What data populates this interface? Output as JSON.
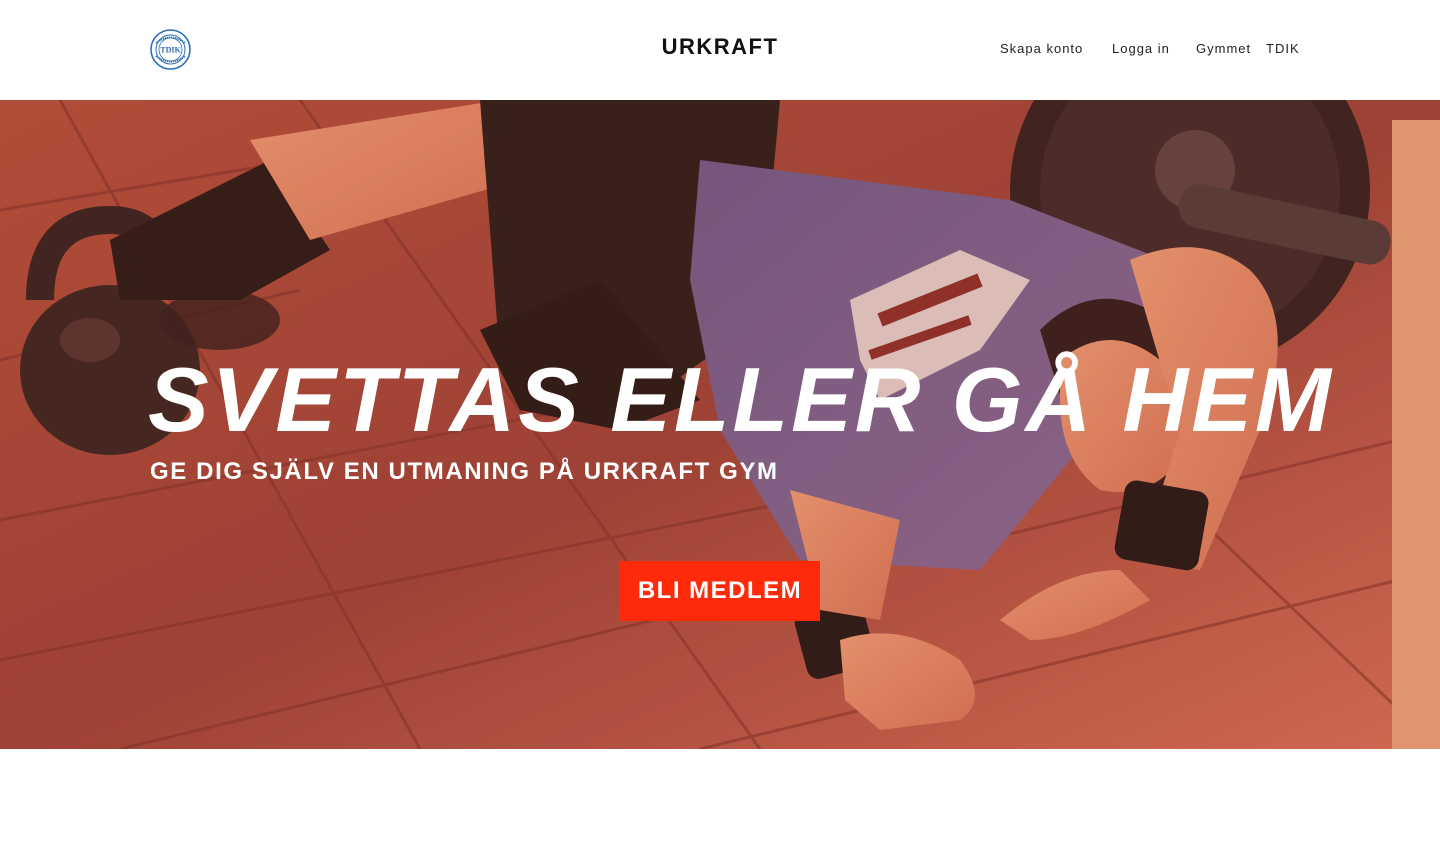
{
  "header": {
    "logo_text": "TDIK",
    "brand": "URKRAFT",
    "nav": [
      {
        "label": "Skapa konto"
      },
      {
        "label": "Logga in"
      },
      {
        "label": "Gymmet"
      },
      {
        "label": "TDIK"
      }
    ]
  },
  "hero": {
    "title": "SVETTAS ELLER GÅ HEM",
    "subtitle": "GE DIG SJÄLV EN UTMANING PÅ URKRAFT GYM",
    "cta_label": "BLI MEDLEM",
    "image_subject": "athlete-lying-on-gym-floor-photo"
  },
  "colors": {
    "cta": "#ff2a0a",
    "logo_blue": "#2a6fb8",
    "hero_tint": "#c9604a"
  }
}
